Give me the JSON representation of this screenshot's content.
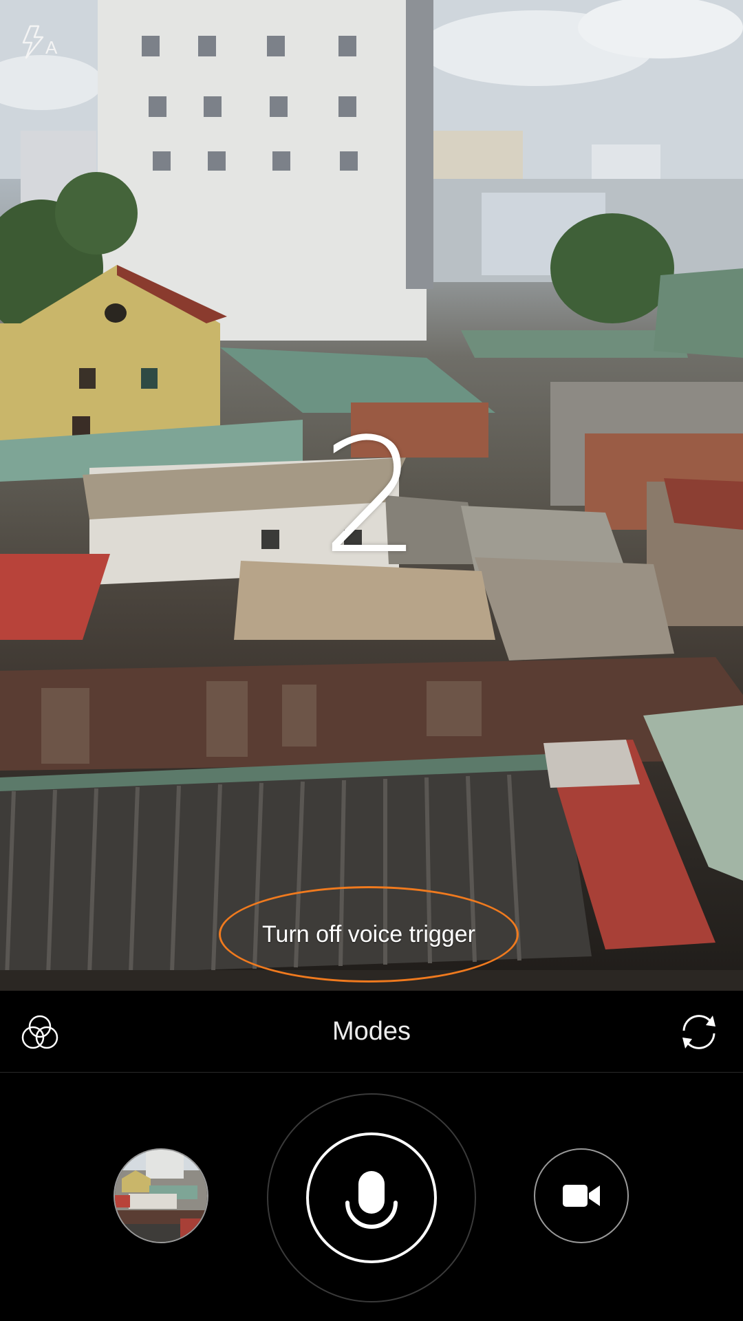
{
  "viewfinder": {
    "flash_mode_letter": "A",
    "countdown": "2",
    "voice_toast": "Turn off voice trigger"
  },
  "modes_bar": {
    "label": "Modes"
  },
  "icons": {
    "flash": "flash-auto-icon",
    "filters": "filters-icon",
    "switch_camera": "switch-camera-icon",
    "shutter": "microphone-icon",
    "video": "video-camera-icon"
  },
  "colors": {
    "toast_outline": "#f07a1e",
    "bar_background": "#000000",
    "icon": "#ffffff"
  }
}
